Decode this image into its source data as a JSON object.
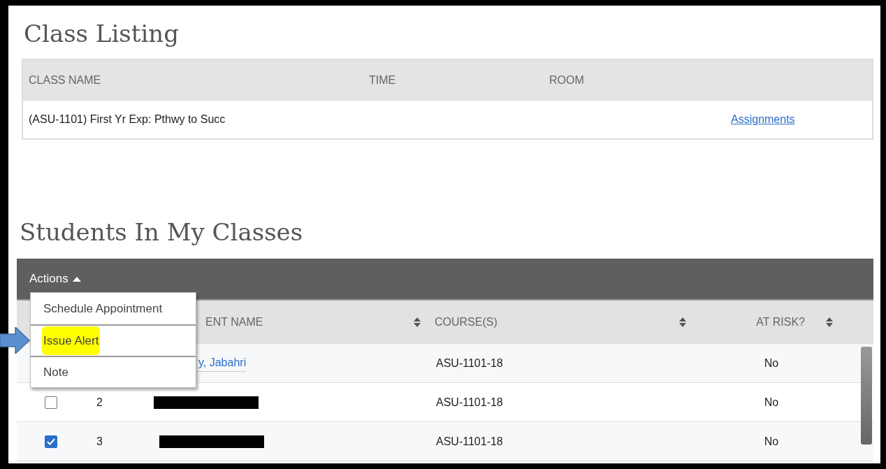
{
  "class_listing": {
    "title": "Class Listing",
    "columns": [
      "CLASS NAME",
      "TIME",
      "ROOM"
    ],
    "rows": [
      {
        "class_name": "(ASU-1101) First Yr Exp: Pthwy to Succ",
        "link": "Assignments"
      }
    ]
  },
  "students": {
    "title": "Students In My Classes",
    "actions_button": "Actions",
    "actions_menu": [
      {
        "label": "Schedule Appointment",
        "highlighted": false
      },
      {
        "label": "Issue Alert",
        "highlighted": true
      },
      {
        "label": "Note",
        "highlighted": false
      }
    ],
    "columns": [
      "ENT NAME",
      "COURSE(S)",
      "AT RISK?"
    ],
    "rows": [
      {
        "name": "y, Jabahri",
        "course": "ASU-1101-18",
        "at_risk": "No"
      },
      {
        "number": "2",
        "checked": false,
        "redacted": true,
        "course": "ASU-1101-18",
        "at_risk": "No"
      },
      {
        "number": "3",
        "checked": true,
        "redacted": true,
        "course": "ASU-1101-18",
        "at_risk": "No"
      }
    ]
  }
}
